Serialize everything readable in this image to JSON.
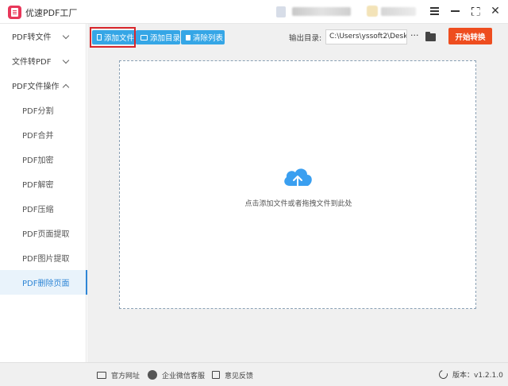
{
  "app": {
    "title": "优速PDF工厂"
  },
  "sidebar": {
    "groups": [
      {
        "label": "PDF转文件"
      },
      {
        "label": "文件转PDF"
      },
      {
        "label": "PDF文件操作"
      }
    ],
    "items": [
      {
        "label": "PDF分割"
      },
      {
        "label": "PDF合并"
      },
      {
        "label": "PDF加密"
      },
      {
        "label": "PDF解密"
      },
      {
        "label": "PDF压缩"
      },
      {
        "label": "PDF页面提取"
      },
      {
        "label": "PDF图片提取"
      },
      {
        "label": "PDF删除页面"
      }
    ],
    "active_item": "PDF删除页面"
  },
  "toolbar": {
    "add_file": "添加文件",
    "add_dir": "添加目录",
    "clear_list": "清除列表",
    "output_label": "输出目录:",
    "output_path": "C:\\Users\\yssoft2\\Deskt",
    "more": "···",
    "start": "开始转换"
  },
  "dropzone": {
    "hint": "点击添加文件或者拖拽文件到此处"
  },
  "footer": {
    "website": "官方网址",
    "wechat_support": "企业微信客服",
    "feedback": "意见反馈",
    "version": "版本：v1.2.1.0"
  },
  "colors": {
    "accent_blue": "#35a6e6",
    "start_orange": "#ee4d1f",
    "active_blue": "#2f86d6",
    "annotation_red": "#d8262b"
  }
}
